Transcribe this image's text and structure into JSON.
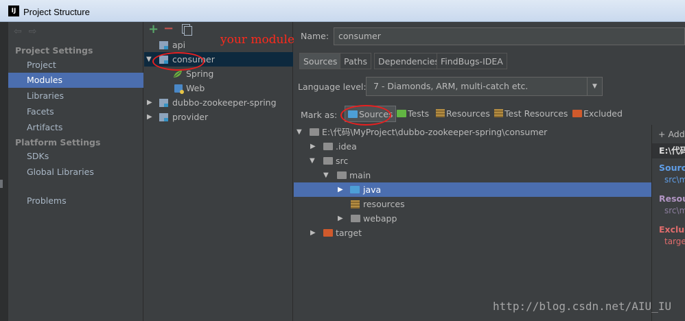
{
  "window": {
    "title": "Project Structure",
    "app_icon": "IJ"
  },
  "annotation": {
    "text": "your module",
    "color": "#ff2a1c"
  },
  "sidebar": {
    "project_settings_header": "Project Settings",
    "platform_settings_header": "Platform Settings",
    "items": [
      {
        "label": "Project"
      },
      {
        "label": "Modules",
        "selected": true
      },
      {
        "label": "Libraries"
      },
      {
        "label": "Facets"
      },
      {
        "label": "Artifacts"
      },
      {
        "label": "SDKs"
      },
      {
        "label": "Global Libraries"
      },
      {
        "label": "Problems"
      }
    ]
  },
  "modules": {
    "items": [
      {
        "label": "api"
      },
      {
        "label": "consumer",
        "selected": true,
        "expanded": true
      },
      {
        "label": "Spring"
      },
      {
        "label": "Web"
      },
      {
        "label": "dubbo-zookeeper-spring"
      },
      {
        "label": "provider"
      }
    ]
  },
  "module_settings": {
    "name_label": "Name:",
    "name_value": "consumer",
    "tabs": [
      {
        "label": "Sources",
        "active": true
      },
      {
        "label": "Paths"
      },
      {
        "label": "Dependencies"
      },
      {
        "label": "FindBugs-IDEA"
      }
    ],
    "language_level_label": "Language level:",
    "language_level_value": "7 - Diamonds, ARM, multi-catch etc.",
    "mark_as_label": "Mark as:",
    "mark_as_buttons": [
      {
        "label": "Sources",
        "color": "#4d9fd6"
      },
      {
        "label": "Tests",
        "color": "#62b543"
      },
      {
        "label": "Resources"
      },
      {
        "label": "Test Resources"
      },
      {
        "label": "Excluded",
        "color": "#d05a2c"
      }
    ]
  },
  "file_tree": {
    "rows": [
      {
        "label": "E:\\代码\\MyProject\\dubbo-zookeeper-spring\\consumer"
      },
      {
        "label": ".idea"
      },
      {
        "label": "src"
      },
      {
        "label": "main"
      },
      {
        "label": "java",
        "selected": true
      },
      {
        "label": "resources"
      },
      {
        "label": "webapp"
      },
      {
        "label": "target"
      }
    ]
  },
  "roots_panel": {
    "add_label": "+ Add",
    "path_header": "E:\\代码",
    "source_folders_label": "Source",
    "source_folders_path": "src\\m",
    "resource_folders_label": "Resou",
    "resource_folders_path": "src\\m",
    "excluded_folders_label": "Exclud",
    "excluded_folders_path": "targe",
    "colors": {
      "source": "#5f9ee8",
      "resource": "#b295c4",
      "excluded": "#e06c6c"
    }
  },
  "watermark": "http://blog.csdn.net/AIU_IU"
}
